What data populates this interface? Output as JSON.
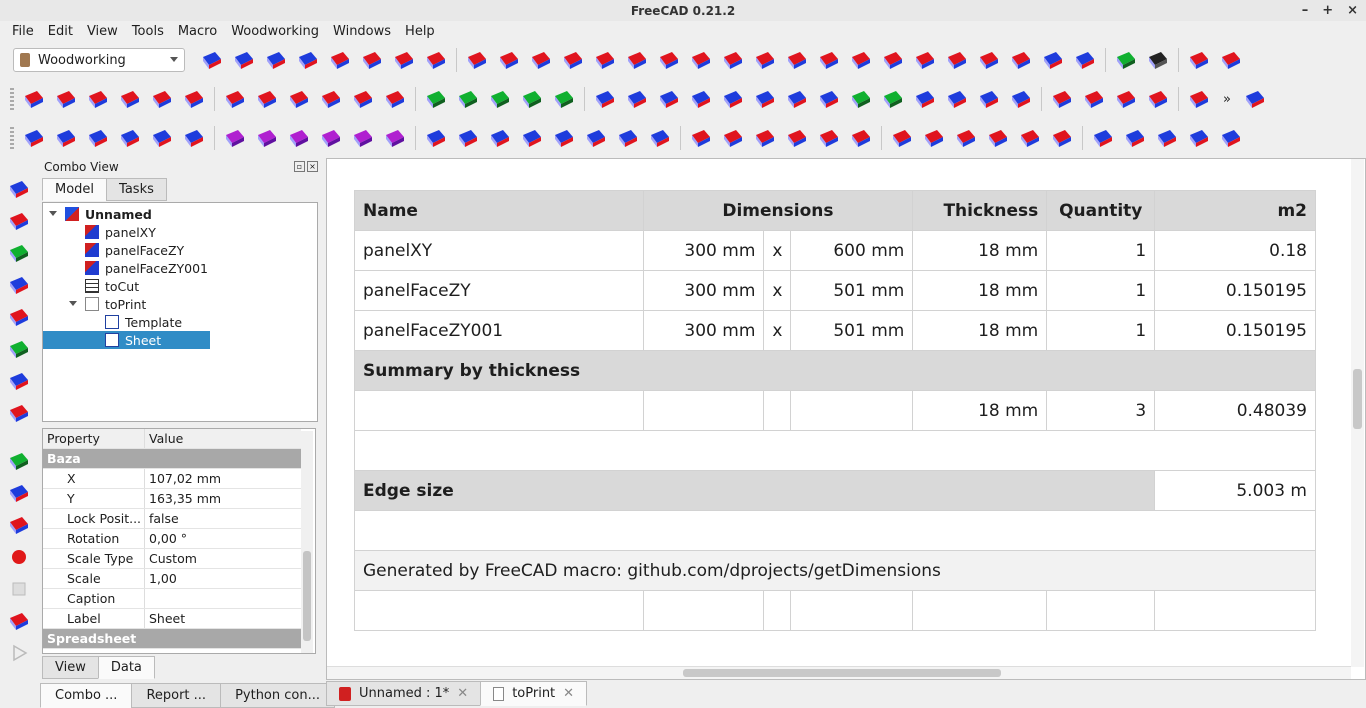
{
  "window": {
    "title": "FreeCAD 0.21.2",
    "controls": [
      "–",
      "+",
      "×"
    ]
  },
  "menu": [
    "File",
    "Edit",
    "View",
    "Tools",
    "Macro",
    "Woodworking",
    "Windows",
    "Help"
  ],
  "workbench": "Woodworking",
  "combo": {
    "title": "Combo View",
    "tabs": [
      "Model",
      "Tasks"
    ],
    "tree": [
      {
        "label": "Unnamed",
        "depth": 0,
        "icon": "document-icon",
        "bold": true
      },
      {
        "label": "panelXY",
        "depth": 1,
        "icon": "panel-icon"
      },
      {
        "label": "panelFaceZY",
        "depth": 1,
        "icon": "panel-icon"
      },
      {
        "label": "panelFaceZY001",
        "depth": 1,
        "icon": "panel-icon"
      },
      {
        "label": "toCut",
        "depth": 1,
        "icon": "spreadsheet-icon"
      },
      {
        "label": "toPrint",
        "depth": 1,
        "icon": "page-icon"
      },
      {
        "label": "Template",
        "depth": 2,
        "icon": "template-icon"
      },
      {
        "label": "Sheet",
        "depth": 2,
        "icon": "sheet-view-icon",
        "selected": true
      }
    ],
    "props": {
      "headers": [
        "Property",
        "Value"
      ],
      "rows": [
        {
          "group": "Baza"
        },
        {
          "key": "X",
          "value": "107,02 mm"
        },
        {
          "key": "Y",
          "value": "163,35 mm"
        },
        {
          "key": "Lock Posit...",
          "value": "false"
        },
        {
          "key": "Rotation",
          "value": "0,00 °"
        },
        {
          "key": "Scale Type",
          "value": "Custom"
        },
        {
          "key": "Scale",
          "value": "1,00"
        },
        {
          "key": "Caption",
          "value": ""
        },
        {
          "key": "Label",
          "value": "Sheet"
        },
        {
          "group": "Spreadsheet"
        }
      ]
    },
    "viewTabs": [
      "View",
      "Data"
    ]
  },
  "bottomTabs": [
    "Combo ...",
    "Report ...",
    "Python con..."
  ],
  "docTabs": [
    "Unnamed : 1*",
    "toPrint"
  ],
  "sheet": {
    "headers": {
      "name": "Name",
      "dimensions": "Dimensions",
      "thickness": "Thickness",
      "quantity": "Quantity",
      "area": "m2"
    },
    "rows": [
      {
        "name": "panelXY",
        "w": "300 mm",
        "x": "x",
        "h": "600 mm",
        "t": "18 mm",
        "q": "1",
        "a": "0.18"
      },
      {
        "name": "panelFaceZY",
        "w": "300 mm",
        "x": "x",
        "h": "501 mm",
        "t": "18 mm",
        "q": "1",
        "a": "0.150195"
      },
      {
        "name": "panelFaceZY001",
        "w": "300 mm",
        "x": "x",
        "h": "501 mm",
        "t": "18 mm",
        "q": "1",
        "a": "0.150195"
      }
    ],
    "summary": {
      "title": "Summary by thickness",
      "t": "18 mm",
      "q": "3",
      "a": "0.48039"
    },
    "edge": {
      "title": "Edge size",
      "value": "5.003 m"
    },
    "footer": "Generated by FreeCAD macro: github.com/dprojects/getDimensions"
  },
  "colors": {
    "selection": "#308cc6",
    "header": "#d9d9d9",
    "panelRed": "#e0141e",
    "panelBlue": "#1e3cdc"
  }
}
